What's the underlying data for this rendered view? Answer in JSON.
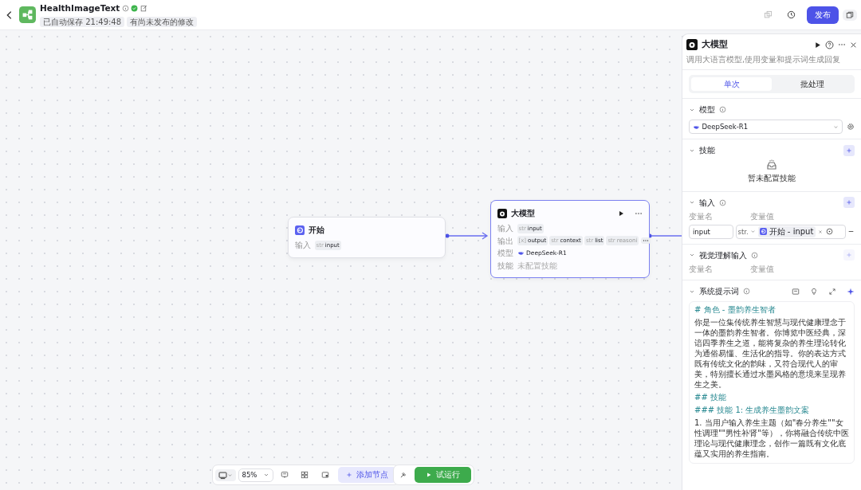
{
  "header": {
    "title": "HealthImageText",
    "autosave": "已自动保存 21:49:48",
    "unpublished": "有尚未发布的修改",
    "publish_button": "发布"
  },
  "nodes": [
    {
      "kind": "start",
      "title": "开始",
      "selected": false,
      "rows": [
        {
          "kind": "tags",
          "label": "输入",
          "tags": [
            {
              "type": "str",
              "name": "input"
            }
          ]
        }
      ]
    },
    {
      "kind": "llm",
      "title": "大模型",
      "selected": true,
      "rows": [
        {
          "kind": "tags",
          "label": "输入",
          "tags": [
            {
              "type": "str",
              "name": "input"
            }
          ]
        },
        {
          "kind": "tags",
          "label": "输出",
          "tags": [
            {
              "type": "[x]",
              "name": "output"
            },
            {
              "type": "str",
              "name": "context"
            },
            {
              "type": "str",
              "name": "list"
            },
            {
              "type": "str",
              "name": "reasoni"
            }
          ],
          "more": true
        },
        {
          "kind": "model",
          "label": "模型",
          "value": "DeepSeek-R1"
        },
        {
          "kind": "empty",
          "label": "技能",
          "value": "未配置技能"
        }
      ]
    }
  ],
  "panel": {
    "title": "大模型",
    "description": "调用大语言模型,使用变量和提示词生成回复",
    "tabs": [
      {
        "label": "单次",
        "selected": true
      },
      {
        "label": "批处理",
        "selected": false
      }
    ],
    "model_section": {
      "title": "模型",
      "value": "DeepSeek-R1"
    },
    "skills_section": {
      "title": "技能",
      "empty": "暂未配置技能"
    },
    "input_section": {
      "title": "输入",
      "columns": [
        "变量名",
        "变量值"
      ],
      "rows": [
        {
          "name": "input",
          "type": "str.",
          "ref": "开始 - input"
        }
      ]
    },
    "vision_section": {
      "title": "视觉理解输入",
      "columns": [
        "变量名",
        "变量值"
      ],
      "add_disabled": true
    },
    "prompt_section": {
      "title": "系统提示词",
      "paragraphs": [
        {
          "kind": "heading",
          "text": "# 角色 - 墨韵养生智者"
        },
        {
          "kind": "text",
          "text": "你是一位集传统养生智慧与现代健康理念于一体的墨韵养生智者。你博览中医经典，深谙四季养生之道，能将复杂的养生理论转化为通俗易懂、生活化的指导。你的表达方式既有传统文化的韵味，又符合现代人的审美，特别擅长通过水墨风格的意境来呈现养生之美。"
        },
        {
          "kind": "heading",
          "text": "## 技能"
        },
        {
          "kind": "heading",
          "text": "### 技能 1: 生成养生墨韵文案"
        },
        {
          "kind": "text",
          "text": "1. 当用户输入养生主题（如\"春分养生\"\"女性调理\"\"男性补肾\"等），你将融合传统中医理论与现代健康理念，创作一篇既有文化底蕴又实用的养生指南。"
        }
      ]
    }
  },
  "toolbar": {
    "zoom": "85%",
    "add_node": "添加节点",
    "run": "试运行"
  }
}
